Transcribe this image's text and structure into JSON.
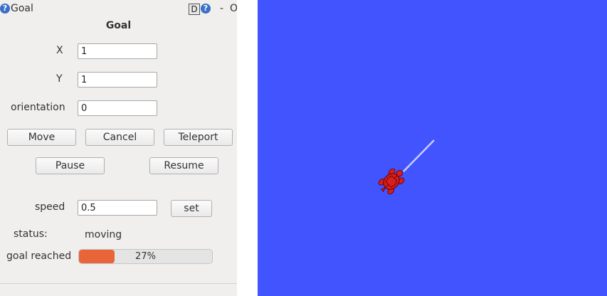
{
  "window": {
    "title": "Goal",
    "help_glyph": "?",
    "d_label": "D",
    "minimize_label": "-",
    "close_label": "O"
  },
  "form": {
    "heading": "Goal",
    "x_label": "X",
    "x_value": "1",
    "y_label": "Y",
    "y_value": "1",
    "orientation_label": "orientation",
    "orientation_value": "0",
    "speed_label": "speed",
    "speed_value": "0.5",
    "status_label": "status:",
    "status_value": "moving",
    "goal_label": "goal reached",
    "progress_percent": 27,
    "progress_text": "27%"
  },
  "buttons": {
    "move": "Move",
    "cancel": "Cancel",
    "teleport": "Teleport",
    "pause": "Pause",
    "resume": "Resume",
    "set": "set"
  },
  "colors": {
    "canvas_bg": "#4154fe",
    "progress_fill": "#e8653a",
    "turtle": "#d42020",
    "trail": "#c9ccff"
  },
  "icons": [
    "help-icon",
    "turtle-icon"
  ]
}
